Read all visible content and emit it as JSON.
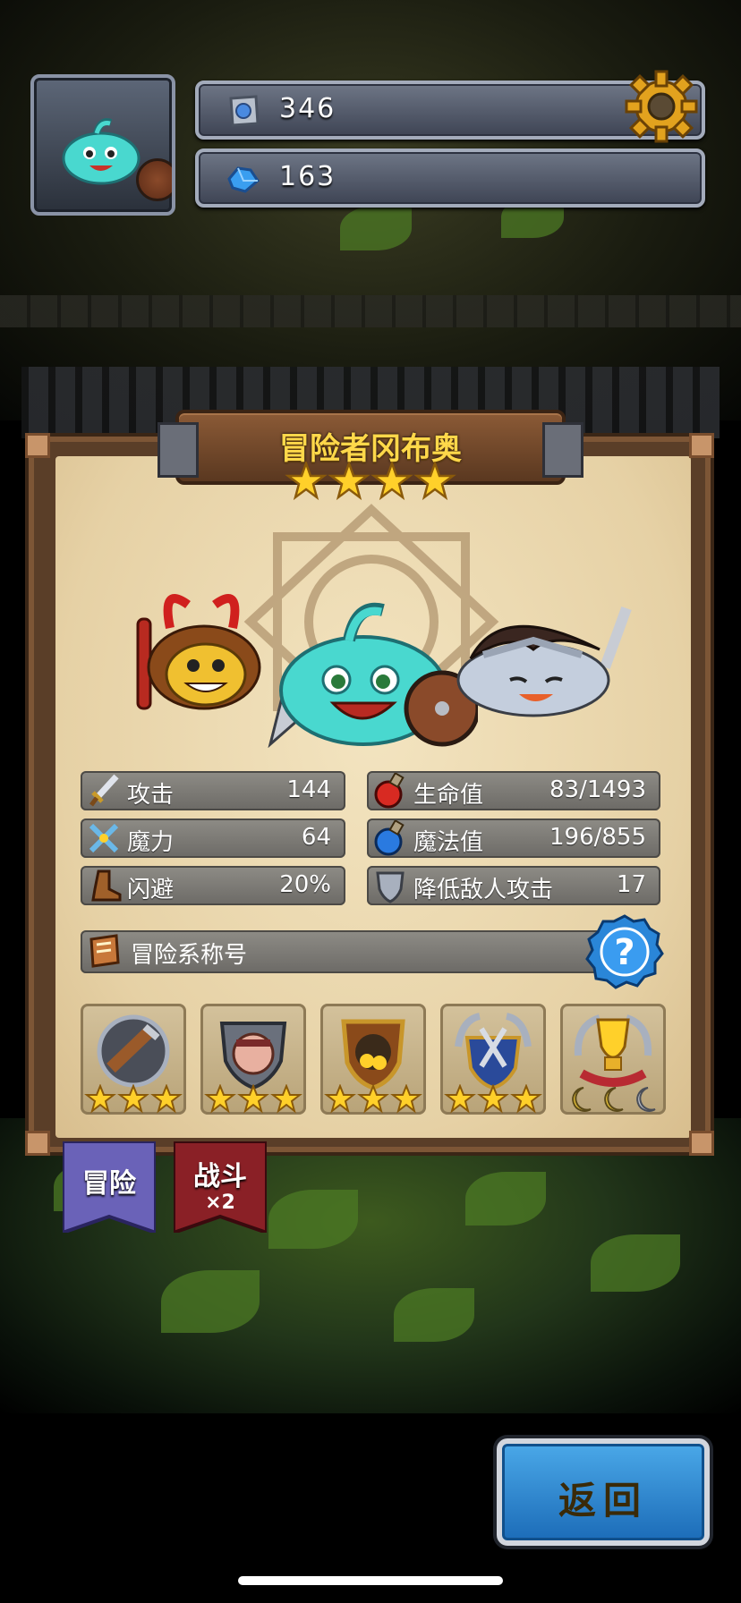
{
  "resources": {
    "stone_value": "346",
    "gem_value": "163"
  },
  "character": {
    "name": "冒险者冈布奥",
    "stars": 4
  },
  "stats": [
    {
      "label": "攻击",
      "value": "144"
    },
    {
      "label": "魔力",
      "value": "64"
    },
    {
      "label": "闪避",
      "value": "20%"
    },
    {
      "label": "生命值",
      "value": "83/1493"
    },
    {
      "label": "魔法值",
      "value": "196/855"
    },
    {
      "label": "降低敌人攻击",
      "value": "17"
    }
  ],
  "title_row": {
    "label": "冒险系称号"
  },
  "badges": [
    {
      "name": "telescope-badge",
      "stars": 3
    },
    {
      "name": "pirate-badge",
      "stars": 3
    },
    {
      "name": "gold-pot-badge",
      "stars": 3
    },
    {
      "name": "weapons-badge",
      "stars": 3
    },
    {
      "name": "trophy-badge",
      "stars": 3
    }
  ],
  "tabs": [
    {
      "label": "冒险",
      "sub": ""
    },
    {
      "label": "战斗",
      "sub": "×2"
    }
  ],
  "back_button": {
    "label": "返回"
  },
  "colors": {
    "gold": "#ffd84a",
    "button_blue": "#2f86cf",
    "tab_purple": "#6a62b8",
    "tab_red": "#8a2026"
  }
}
